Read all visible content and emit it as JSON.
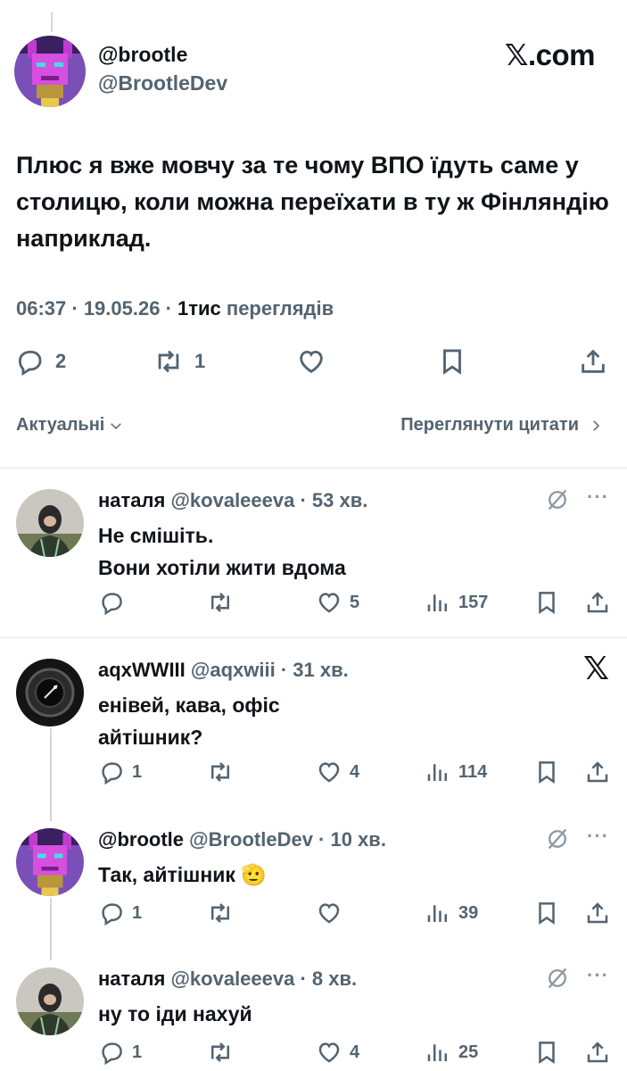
{
  "main_tweet": {
    "display_name": "@brootle",
    "handle": "@BrootleDev",
    "site_label": "𝕏.com",
    "text": "Плюс я вже мовчу за те чому ВПО їдуть саме у столицю, коли можна переїхати в ту ж Фінляндію наприклад.",
    "time": "06:37 · 19.05.26 · ",
    "views_count": "1тис",
    "views_label": " переглядів",
    "replies": "2",
    "retweets": "1"
  },
  "sort": {
    "relevance_label": "Актуальні",
    "quotes_label": "Переглянути цитати"
  },
  "replies": [
    {
      "name": "наталя",
      "handle_time": " @kovaleeeva · 53 хв.",
      "lines": [
        "Не смішіть.",
        "Вони хотіли жити вдома"
      ],
      "replies": "",
      "retweets": "",
      "likes": "5",
      "views": "157",
      "avatar": "person-avatar",
      "right_icon": "grok-icon"
    },
    {
      "name": "aqxWWIII",
      "handle_time": " @aqxwiii · 31 хв.",
      "lines": [
        "енівей, кава, офіс",
        "айтішник?"
      ],
      "replies": "1",
      "retweets": "",
      "likes": "4",
      "views": "114",
      "avatar": "camera-lens-avatar",
      "right_icon": "x-logo-icon",
      "x_glyph": "𝕏"
    },
    {
      "name": "@brootle",
      "handle_time": " @BrootleDev · 10 хв.",
      "lines": [
        "Так, айтішник 🫡"
      ],
      "replies": "1",
      "retweets": "",
      "likes": "",
      "views": "39",
      "avatar": "pixel-art-avatar",
      "right_icon": "grok-icon"
    },
    {
      "name": "наталя",
      "handle_time": " @kovaleeeva · 8 хв.",
      "lines": [
        "ну то іди нахуй"
      ],
      "replies": "1",
      "retweets": "",
      "likes": "4",
      "views": "25",
      "avatar": "person-avatar",
      "right_icon": "grok-icon"
    }
  ],
  "more_label": "···",
  "colors": {
    "text": "#0f1419",
    "muted": "#536471",
    "divider": "#e1e6ea"
  }
}
